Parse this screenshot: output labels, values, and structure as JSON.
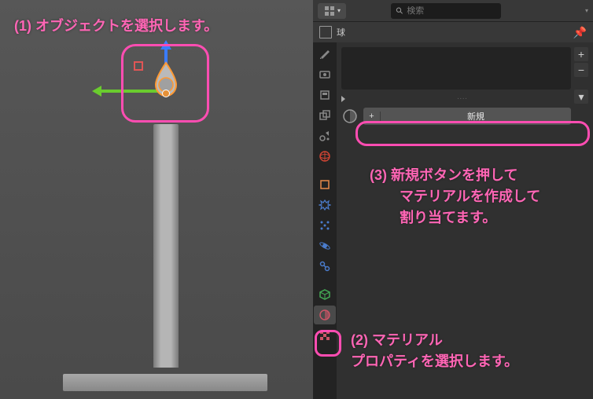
{
  "annotations": {
    "step1": "(1) オブジェクトを選択します。",
    "step2_line1": "(2) マテリアル",
    "step2_line2": "プロパティを選択します。",
    "step3_line1": "(3) 新規ボタンを押して",
    "step3_line2": "マテリアルを作成して",
    "step3_line3": "割り当てます。"
  },
  "panel": {
    "search_placeholder": "検索",
    "object_name": "球",
    "new_button_label": "新規",
    "dots": "····"
  },
  "tab_icons": [
    {
      "name": "tool-icon",
      "color": "#888"
    },
    {
      "name": "render-icon",
      "color": "#888"
    },
    {
      "name": "output-icon",
      "color": "#888"
    },
    {
      "name": "viewlayer-icon",
      "color": "#888"
    },
    {
      "name": "scene-icon",
      "color": "#888"
    },
    {
      "name": "world-icon",
      "color": "#cc4433"
    },
    {
      "name": "spacer"
    },
    {
      "name": "object-icon",
      "color": "#e8894a"
    },
    {
      "name": "modifier-icon",
      "color": "#4a7ccc"
    },
    {
      "name": "particle-icon",
      "color": "#4a7ccc"
    },
    {
      "name": "physics-icon",
      "color": "#4a7ccc"
    },
    {
      "name": "constraint-icon",
      "color": "#4a7ccc"
    },
    {
      "name": "spacer"
    },
    {
      "name": "data-icon",
      "color": "#44aa55"
    },
    {
      "name": "material-icon",
      "color": "#cc5566",
      "active": true
    },
    {
      "name": "texture-icon",
      "color": "#cc5566"
    }
  ]
}
